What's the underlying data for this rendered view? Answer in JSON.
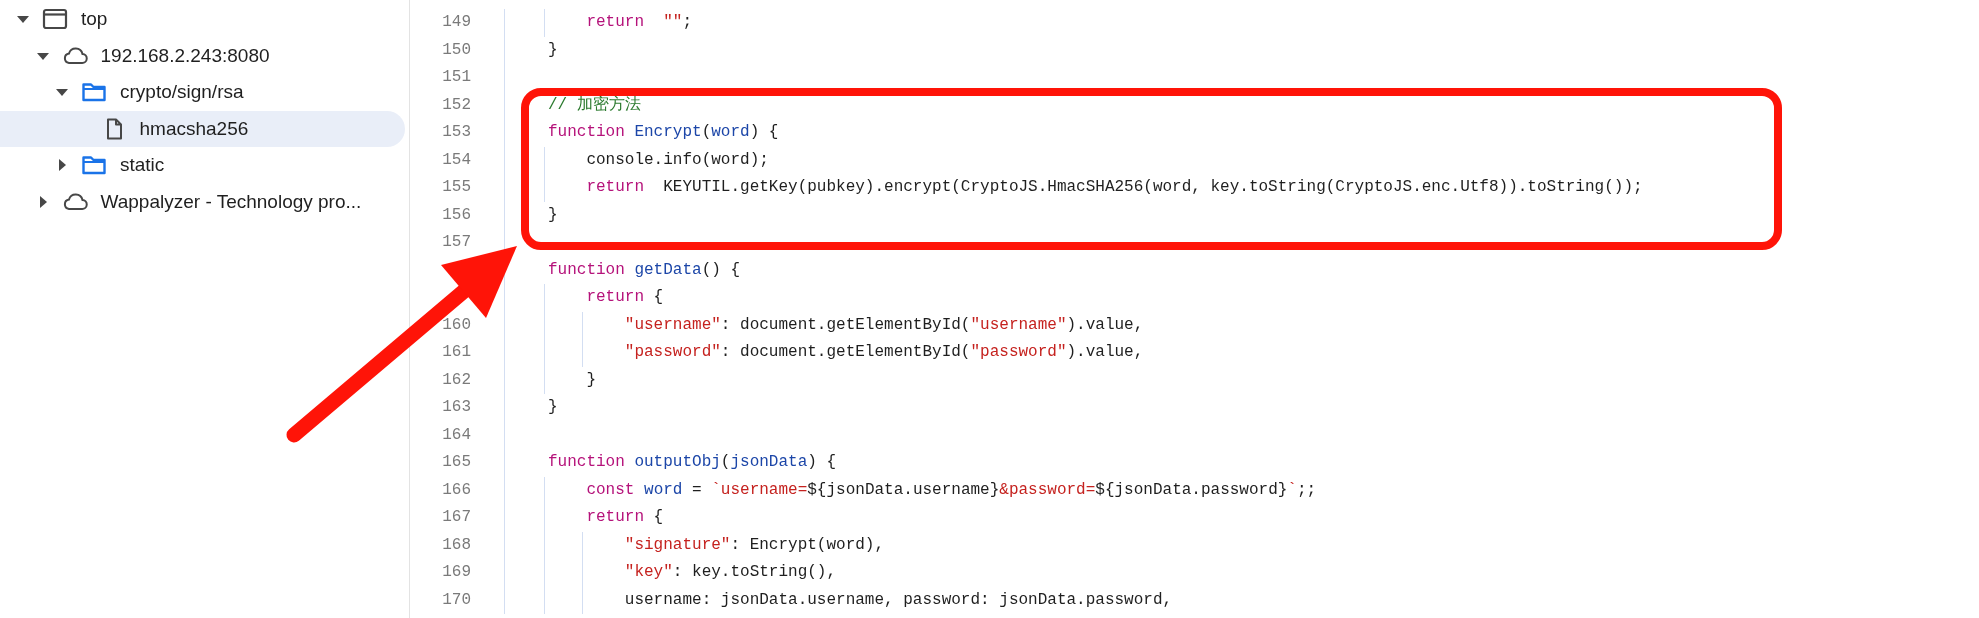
{
  "sidebar": {
    "tree": [
      {
        "label": "top",
        "kind": "frame",
        "expanded": true,
        "selected": false,
        "children": [
          {
            "label": "192.168.2.243:8080",
            "kind": "cloud",
            "expanded": true,
            "selected": false,
            "children": [
              {
                "label": "crypto/sign/rsa",
                "kind": "folder",
                "expanded": true,
                "selected": false,
                "children": [
                  {
                    "label": "hmacsha256",
                    "kind": "file",
                    "selected": true
                  }
                ]
              },
              {
                "label": "static",
                "kind": "folder",
                "expanded": false,
                "selected": false
              }
            ]
          },
          {
            "label": "Wappalyzer - Technology pro...",
            "kind": "cloud",
            "expanded": false,
            "selected": false
          }
        ]
      }
    ]
  },
  "editor": {
    "lines": [
      {
        "number": "149",
        "tokens": [
          {
            "kind": "keyword",
            "text": "    return"
          },
          {
            "kind": "string",
            "text": "  \"\""
          },
          {
            "kind": "plain",
            "text": ";"
          }
        ]
      },
      {
        "number": "150",
        "tokens": [
          {
            "kind": "plain",
            "text": "}"
          }
        ]
      },
      {
        "number": "151"
      },
      {
        "number": "152",
        "tokens": [
          {
            "kind": "comment",
            "text": "// 加密方法"
          }
        ]
      },
      {
        "number": "153",
        "tokens": [
          {
            "kind": "keyword",
            "text": "function"
          },
          {
            "kind": "name",
            "text": " Encrypt"
          },
          {
            "kind": "plain",
            "text": "("
          },
          {
            "kind": "name",
            "text": "word"
          },
          {
            "kind": "plain",
            "text": ") {"
          }
        ]
      },
      {
        "number": "154",
        "tokens": [
          {
            "kind": "plain",
            "text": "    console.info(word);"
          }
        ]
      },
      {
        "number": "155",
        "tokens": [
          {
            "kind": "keyword",
            "text": "    return"
          },
          {
            "kind": "plain",
            "text": "  KEYUTIL.getKey(pubkey).encrypt(CryptoJS.HmacSHA256(word, key.toString(CryptoJS.enc.Utf8)).toString());"
          }
        ]
      },
      {
        "number": "156",
        "tokens": [
          {
            "kind": "plain",
            "text": "}"
          }
        ]
      },
      {
        "number": "157"
      },
      {
        "tokens": [
          {
            "kind": "keyword",
            "text": "function"
          },
          {
            "kind": "name",
            "text": " getData"
          },
          {
            "kind": "plain",
            "text": "() {"
          }
        ]
      },
      {
        "tokens": [
          {
            "kind": "keyword",
            "text": "    return"
          },
          {
            "kind": "plain",
            "text": " {"
          }
        ]
      },
      {
        "number": "160",
        "tokens": [
          {
            "kind": "string",
            "text": "        \"username\""
          },
          {
            "kind": "plain",
            "text": ": document.getElementById("
          },
          {
            "kind": "string",
            "text": "\"username\""
          },
          {
            "kind": "plain",
            "text": ").value,"
          }
        ]
      },
      {
        "number": "161",
        "tokens": [
          {
            "kind": "string",
            "text": "        \"password\""
          },
          {
            "kind": "plain",
            "text": ": document.getElementById("
          },
          {
            "kind": "string",
            "text": "\"password\""
          },
          {
            "kind": "plain",
            "text": ").value,"
          }
        ]
      },
      {
        "number": "162",
        "tokens": [
          {
            "kind": "plain",
            "text": "    }"
          }
        ]
      },
      {
        "number": "163",
        "tokens": [
          {
            "kind": "plain",
            "text": "}"
          }
        ]
      },
      {
        "number": "164"
      },
      {
        "number": "165",
        "tokens": [
          {
            "kind": "keyword",
            "text": "function"
          },
          {
            "kind": "name",
            "text": " outputObj"
          },
          {
            "kind": "plain",
            "text": "("
          },
          {
            "kind": "name",
            "text": "jsonData"
          },
          {
            "kind": "plain",
            "text": ") {"
          }
        ]
      },
      {
        "number": "166",
        "tokens": [
          {
            "kind": "keyword",
            "text": "    const"
          },
          {
            "kind": "name",
            "text": " word"
          },
          {
            "kind": "plain",
            "text": " = "
          },
          {
            "kind": "string",
            "text": "`username="
          },
          {
            "kind": "plain",
            "text": "${jsonData.username}"
          },
          {
            "kind": "string",
            "text": "&password="
          },
          {
            "kind": "plain",
            "text": "${jsonData.password}"
          },
          {
            "kind": "string",
            "text": "`"
          },
          {
            "kind": "plain",
            "text": ";;"
          }
        ]
      },
      {
        "number": "167",
        "tokens": [
          {
            "kind": "keyword",
            "text": "    return"
          },
          {
            "kind": "plain",
            "text": " {"
          }
        ]
      },
      {
        "number": "168",
        "tokens": [
          {
            "kind": "string",
            "text": "        \"signature\""
          },
          {
            "kind": "plain",
            "text": ": Encrypt(word),"
          }
        ]
      },
      {
        "number": "169",
        "tokens": [
          {
            "kind": "string",
            "text": "        \"key\""
          },
          {
            "kind": "plain",
            "text": ": key.toString(),"
          }
        ]
      },
      {
        "number": "170",
        "tokens": [
          {
            "kind": "plain",
            "text": "        username: jsonData.username, password: jsonData.password,"
          }
        ]
      }
    ]
  }
}
